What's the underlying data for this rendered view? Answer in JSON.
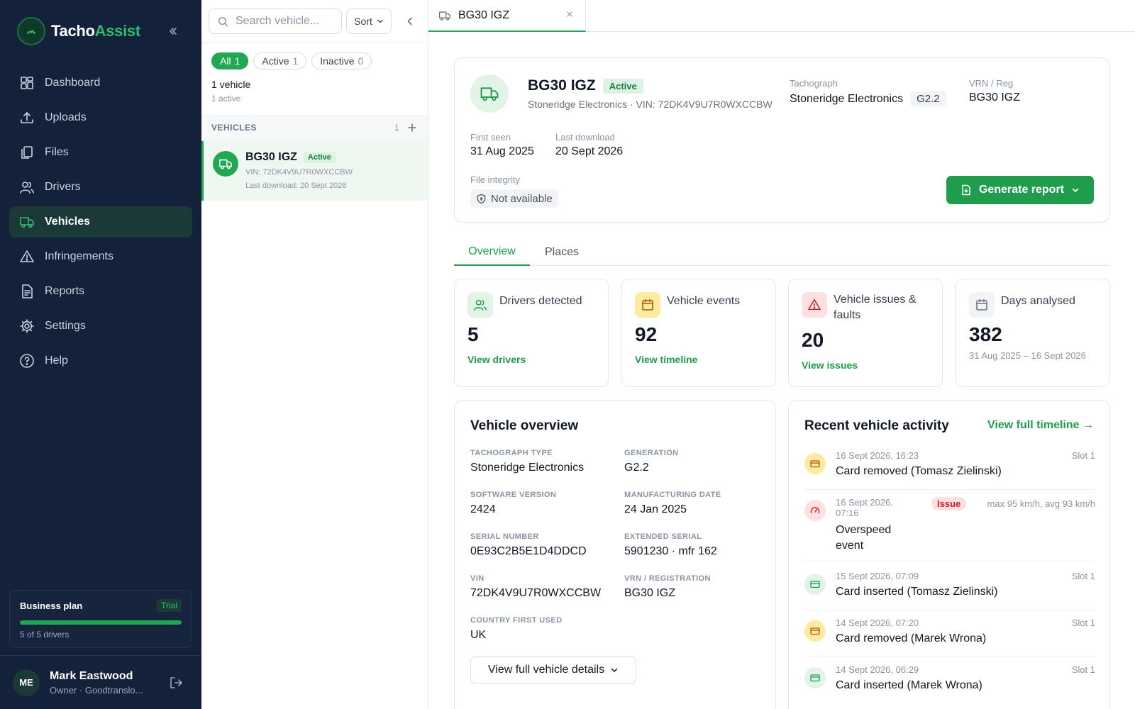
{
  "app": {
    "name_main": "Tacho",
    "name_accent": "Assist"
  },
  "sidebar": {
    "items": [
      {
        "label": "Dashboard",
        "icon": "grid-icon"
      },
      {
        "label": "Uploads",
        "icon": "upload-icon"
      },
      {
        "label": "Files",
        "icon": "files-icon"
      },
      {
        "label": "Drivers",
        "icon": "users-icon"
      },
      {
        "label": "Vehicles",
        "icon": "truck-icon",
        "active": true
      },
      {
        "label": "Infringements",
        "icon": "warning-icon"
      },
      {
        "label": "Reports",
        "icon": "report-icon"
      },
      {
        "label": "Settings",
        "icon": "gear-icon"
      },
      {
        "label": "Help",
        "icon": "help-icon"
      }
    ],
    "plan": {
      "title": "Business plan",
      "badge": "Trial",
      "count": "5 of 5 drivers",
      "usage_fraction": 1.0
    },
    "user": {
      "initials": "ME",
      "name": "Mark Eastwood",
      "role": "Owner · Goodtranslo..."
    }
  },
  "list": {
    "search_placeholder": "Search vehicle...",
    "sort_label": "Sort",
    "filters": [
      {
        "label": "All",
        "count": "1",
        "active": true
      },
      {
        "label": "Active",
        "count": "1"
      },
      {
        "label": "Inactive",
        "count": "0"
      }
    ],
    "summary": "1 vehicle",
    "summary_sub": "1 active",
    "section_label": "VEHICLES",
    "section_count": "1",
    "vehicles": [
      {
        "reg": "BG30 IGZ",
        "status": "Active",
        "vin": "VIN: 72DK4V9U7R0WXCCBW",
        "last_download": "Last download: 20 Sept 2026"
      }
    ]
  },
  "tab": {
    "label": "BG30 IGZ"
  },
  "header": {
    "reg": "BG30 IGZ",
    "status": "Active",
    "subtitle": "Stoneridge Electronics · VIN: 72DK4V9U7R0WXCCBW",
    "tachograph_label": "Tachograph",
    "tachograph_value": "Stoneridge Electronics",
    "generation": "G2.2",
    "vrn_label": "VRN / Reg",
    "vrn_value": "BG30 IGZ",
    "first_seen_label": "First seen",
    "first_seen_value": "31 Aug 2025",
    "last_download_label": "Last download",
    "last_download_value": "20 Sept 2026",
    "integrity_label": "File integrity",
    "integrity_value": "Not available",
    "report_button": "Generate report"
  },
  "tabs": [
    {
      "label": "Overview",
      "active": true
    },
    {
      "label": "Places"
    }
  ],
  "stats": [
    {
      "title": "Drivers detected",
      "value": "5",
      "link": "View drivers",
      "icon": "users-icon",
      "color": "#e3f3e8"
    },
    {
      "title": "Vehicle events",
      "value": "92",
      "link": "View timeline",
      "icon": "calendar-icon",
      "color": "#fdeba0"
    },
    {
      "title": "Vehicle issues & faults",
      "value": "20",
      "link": "View issues",
      "icon": "alert-icon",
      "color": "#fde0e2"
    },
    {
      "title": "Days analysed",
      "value": "382",
      "range": "31 Aug 2025 – 16 Sept 2026",
      "icon": "calendar-icon",
      "color": "#f1f3f5"
    }
  ],
  "overview": {
    "title": "Vehicle overview",
    "fields": [
      {
        "label": "TACHOGRAPH TYPE",
        "value": "Stoneridge Electronics"
      },
      {
        "label": "GENERATION",
        "value": "G2.2"
      },
      {
        "label": "SOFTWARE VERSION",
        "value": "2424"
      },
      {
        "label": "MANUFACTURING DATE",
        "value": "24 Jan 2025"
      },
      {
        "label": "SERIAL NUMBER",
        "value": "0E93C2B5E1D4DDCD"
      },
      {
        "label": "EXTENDED SERIAL",
        "value": "5901230 · mfr 162"
      },
      {
        "label": "VIN",
        "value": "72DK4V9U7R0WXCCBW"
      },
      {
        "label": "VRN / REGISTRATION",
        "value": "BG30 IGZ"
      },
      {
        "label": "COUNTRY FIRST USED",
        "value": "UK"
      }
    ],
    "details_button": "View full vehicle details"
  },
  "activity": {
    "title": "Recent vehicle activity",
    "link": "View full timeline →",
    "items": [
      {
        "time": "16 Sept 2026, 16:23",
        "text": "Card removed (Tomasz Zielinski)",
        "slot": "Slot 1",
        "kind": "card-removed"
      },
      {
        "time_line1": "16 Sept 2026,",
        "time_line2": "07:16",
        "text_line1": "Overspeed",
        "text_line2": "event",
        "badge": "Issue",
        "detail": "max 95 km/h, avg 93 km/h",
        "kind": "overspeed"
      },
      {
        "time": "15 Sept 2026, 07:09",
        "text": "Card inserted (Tomasz Zielinski)",
        "slot": "Slot 1",
        "kind": "card-inserted"
      },
      {
        "time": "14 Sept 2026, 07:20",
        "text": "Card removed (Marek Wrona)",
        "slot": "Slot 1",
        "kind": "card-removed"
      },
      {
        "time": "14 Sept 2026, 06:29",
        "text": "Card inserted (Marek Wrona)",
        "slot": "Slot 1",
        "kind": "card-inserted"
      }
    ]
  },
  "colors": {
    "sidebar_bg": "#14213a",
    "accent": "#22a855",
    "accent_dark": "#1f9d4c",
    "issue": "#c81e2a"
  }
}
